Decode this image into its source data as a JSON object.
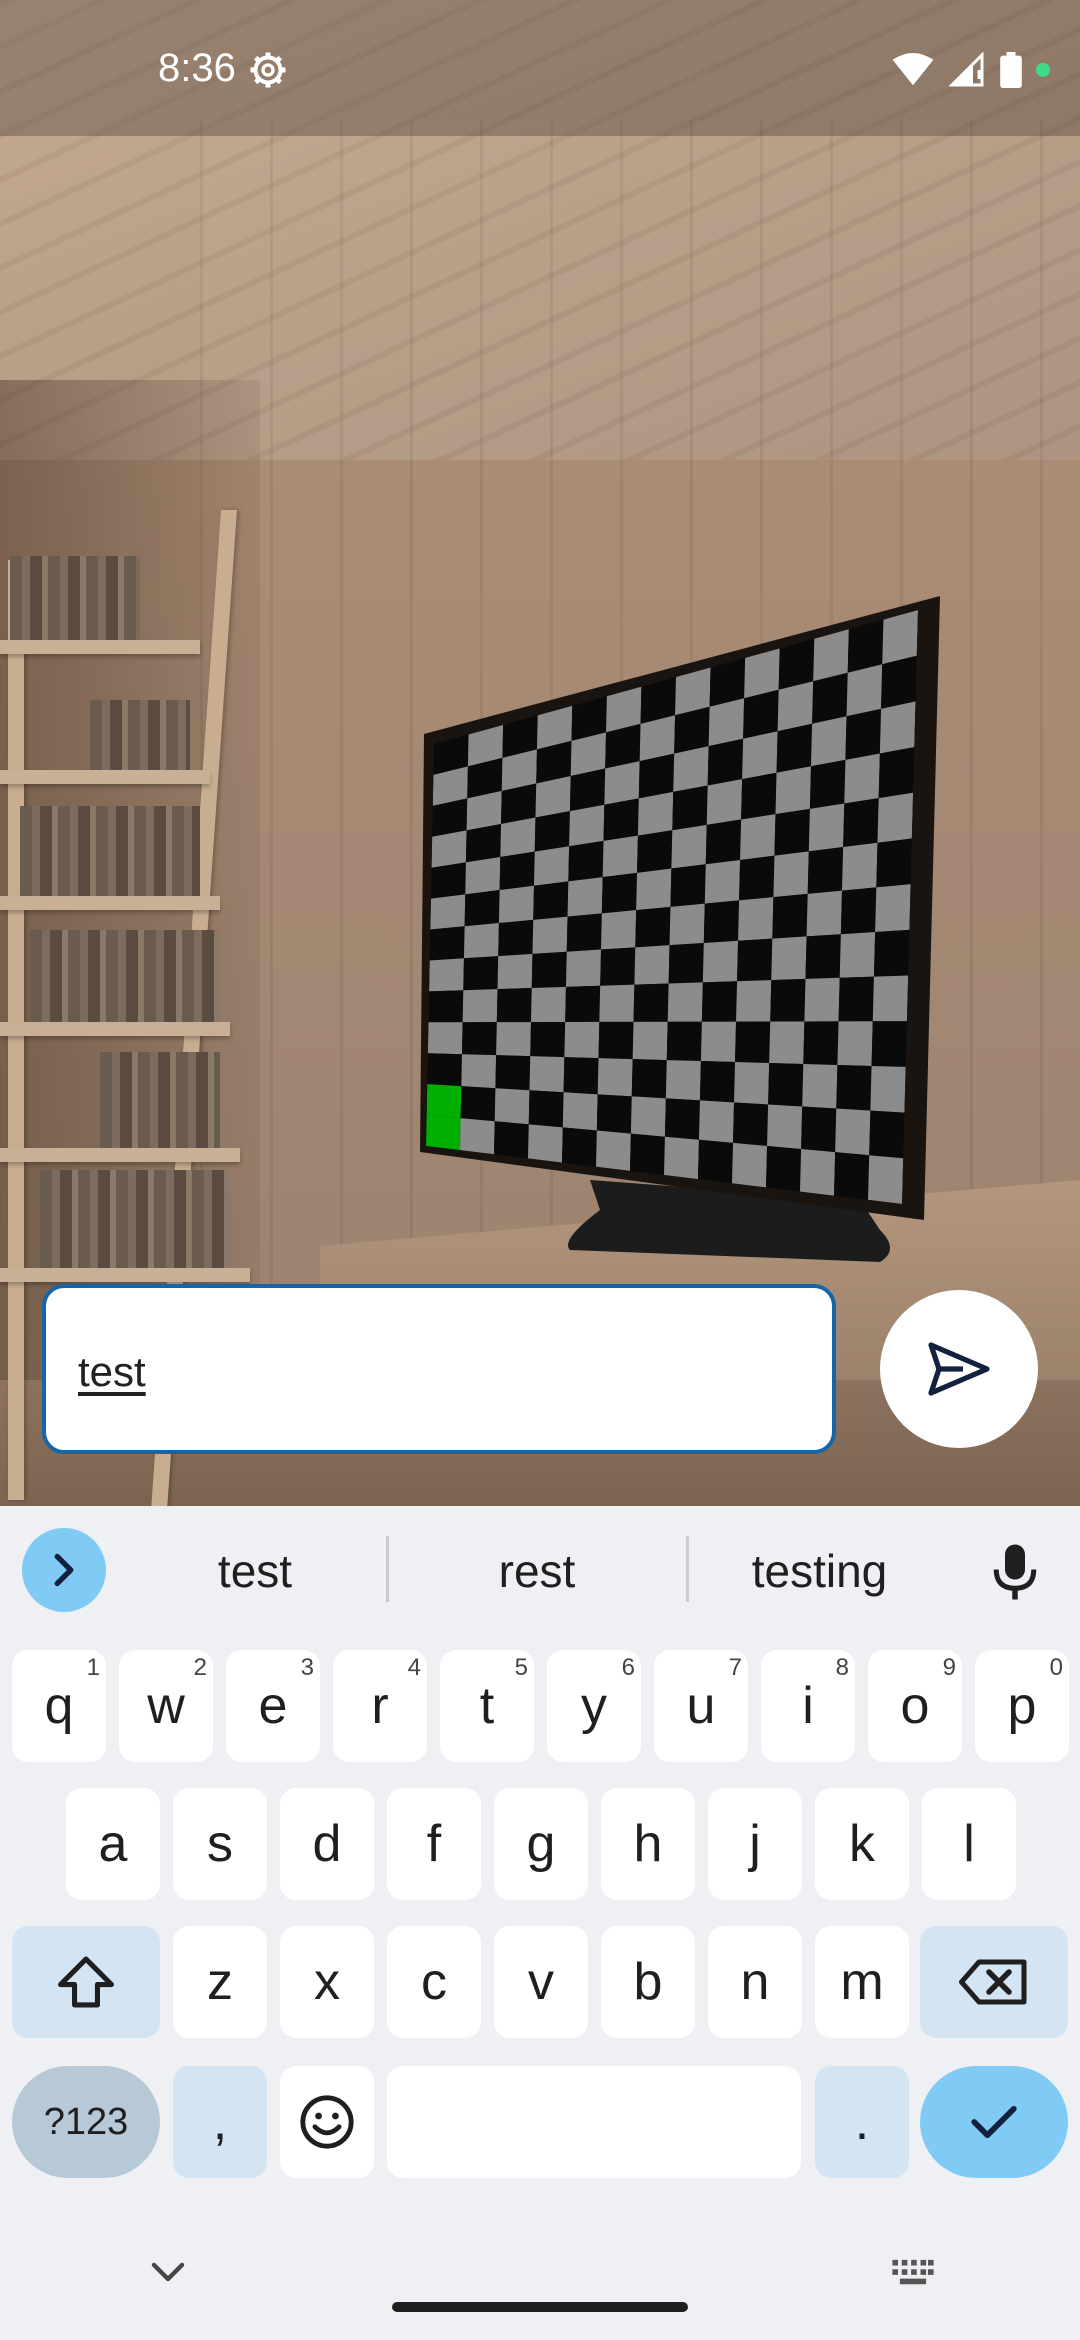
{
  "status_bar": {
    "time": "8:36",
    "icons": [
      "settings-icon",
      "wifi-icon",
      "signal-icon",
      "battery-icon",
      "privacy-dot"
    ]
  },
  "message": {
    "input_value": "test",
    "send_icon": "send-icon"
  },
  "keyboard": {
    "suggestions": [
      "test",
      "rest",
      "testing"
    ],
    "row1": [
      {
        "label": "q",
        "hint": "1"
      },
      {
        "label": "w",
        "hint": "2"
      },
      {
        "label": "e",
        "hint": "3"
      },
      {
        "label": "r",
        "hint": "4"
      },
      {
        "label": "t",
        "hint": "5"
      },
      {
        "label": "y",
        "hint": "6"
      },
      {
        "label": "u",
        "hint": "7"
      },
      {
        "label": "i",
        "hint": "8"
      },
      {
        "label": "o",
        "hint": "9"
      },
      {
        "label": "p",
        "hint": "0"
      }
    ],
    "row2": [
      "a",
      "s",
      "d",
      "f",
      "g",
      "h",
      "j",
      "k",
      "l"
    ],
    "row3": [
      "z",
      "x",
      "c",
      "v",
      "b",
      "n",
      "m"
    ],
    "symbols_label": "?123",
    "comma_label": ",",
    "period_label": "."
  },
  "colors": {
    "accent": "#7fcbf5",
    "input_border": "#1565a8",
    "highlight_square": "#00b000"
  }
}
